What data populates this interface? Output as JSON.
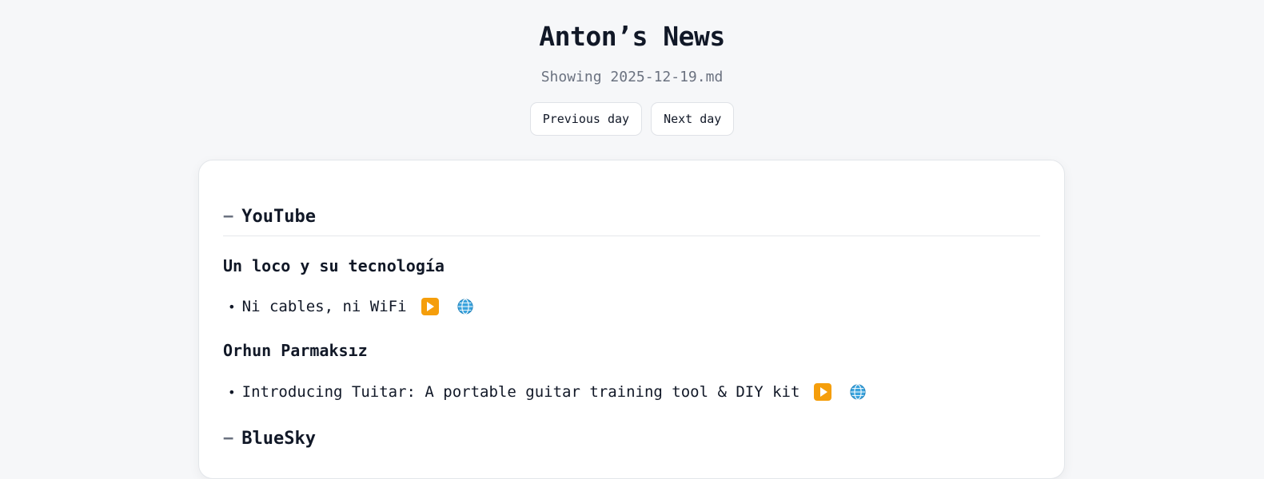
{
  "header": {
    "title": "Anton’s News",
    "subtitle": "Showing 2025-12-19.md"
  },
  "nav": {
    "previous_label": "Previous day",
    "next_label": "Next day"
  },
  "sections": [
    {
      "toggle": "−",
      "name": "YouTube",
      "channels": [
        {
          "name": "Un loco y su tecnología",
          "items": [
            {
              "bullet": "•",
              "title": "Ni cables, ni WiFi",
              "icons": [
                "play-icon",
                "globe-icon"
              ]
            }
          ]
        },
        {
          "name": "Orhun Parmaksız",
          "items": [
            {
              "bullet": "•",
              "title": "Introducing Tuitar: A portable guitar training tool & DIY kit",
              "icons": [
                "play-icon",
                "globe-icon"
              ]
            }
          ]
        }
      ]
    },
    {
      "toggle": "−",
      "name": "BlueSky",
      "channels": []
    }
  ],
  "colors": {
    "background": "#f6f7f9",
    "card": "#ffffff",
    "text": "#111827",
    "muted": "#6b7280",
    "play_accent": "#f59e0b",
    "globe_accent": "#2b9bd6"
  }
}
